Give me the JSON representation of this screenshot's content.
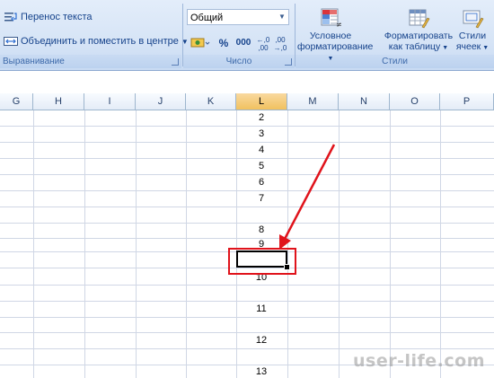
{
  "ribbon": {
    "alignment_group": {
      "wrap_text_label": "Перенос текста",
      "merge_center_label": "Объединить и поместить в центре",
      "group_label": "Выравнивание"
    },
    "number_group": {
      "format_value": "Общий",
      "percent_label": "%",
      "thousands_label": "000",
      "group_label": "Число"
    },
    "styles_group": {
      "conditional_formatting_label_1": "Условное",
      "conditional_formatting_label_2": "форматирование",
      "format_as_table_label_1": "Форматировать",
      "format_as_table_label_2": "как таблицу",
      "cell_styles_label_1": "Стили",
      "cell_styles_label_2": "ячеек",
      "group_label": "Стили"
    }
  },
  "sheet": {
    "columns": [
      "G",
      "H",
      "I",
      "J",
      "K",
      "L",
      "M",
      "N",
      "O",
      "P"
    ],
    "active_column": "L",
    "l_column_values": [
      "2",
      "3",
      "4",
      "5",
      "6",
      "7",
      "8",
      "9",
      "10",
      "11",
      "12",
      "13"
    ]
  },
  "annotation": {
    "arrow_color": "#e0131b",
    "box_color": "#e0131b"
  },
  "watermark": "user-life.com"
}
